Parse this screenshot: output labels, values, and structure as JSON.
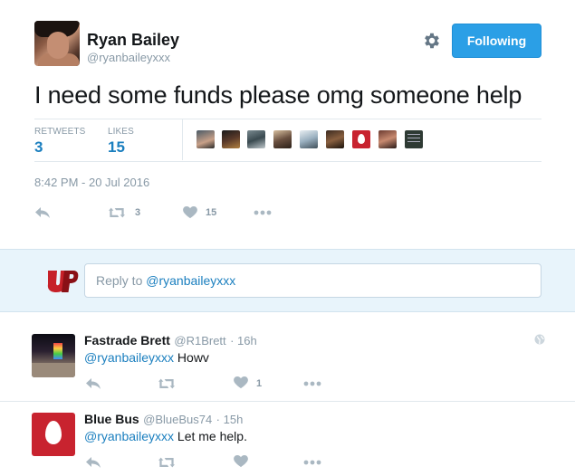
{
  "tweet": {
    "author_name": "Ryan Bailey",
    "author_handle": "@ryanbaileyxxx",
    "follow_label": "Following",
    "text": "I need some funds please omg someone help",
    "retweets_label": "RETWEETS",
    "retweets_count": "3",
    "likes_label": "LIKES",
    "likes_count": "15",
    "timestamp": "8:42 PM - 20 Jul 2016",
    "actions": {
      "retweet_count": "3",
      "like_count": "15"
    }
  },
  "reply_box": {
    "prefix": "Reply to ",
    "mention": "@ryanbaileyxxx"
  },
  "replies": [
    {
      "name": "Fastrade Brett",
      "handle": "@R1Brett",
      "time": "· 16h",
      "mention": "@ryanbaileyxxx",
      "text": " Howv",
      "like_count": "1"
    },
    {
      "name": "Blue Bus",
      "handle": "@BlueBus74",
      "time": "· 15h",
      "mention": "@ryanbaileyxxx",
      "text": " Let me help.",
      "like_count": ""
    }
  ],
  "colors": {
    "accent": "#2b9fe6",
    "link": "#1b7fbf",
    "muted": "#8899a6",
    "reply_band": "#e8f4fb"
  },
  "icons": [
    "gear-icon",
    "reply-icon",
    "retweet-icon",
    "heart-icon",
    "more-icon",
    "globe-icon"
  ]
}
